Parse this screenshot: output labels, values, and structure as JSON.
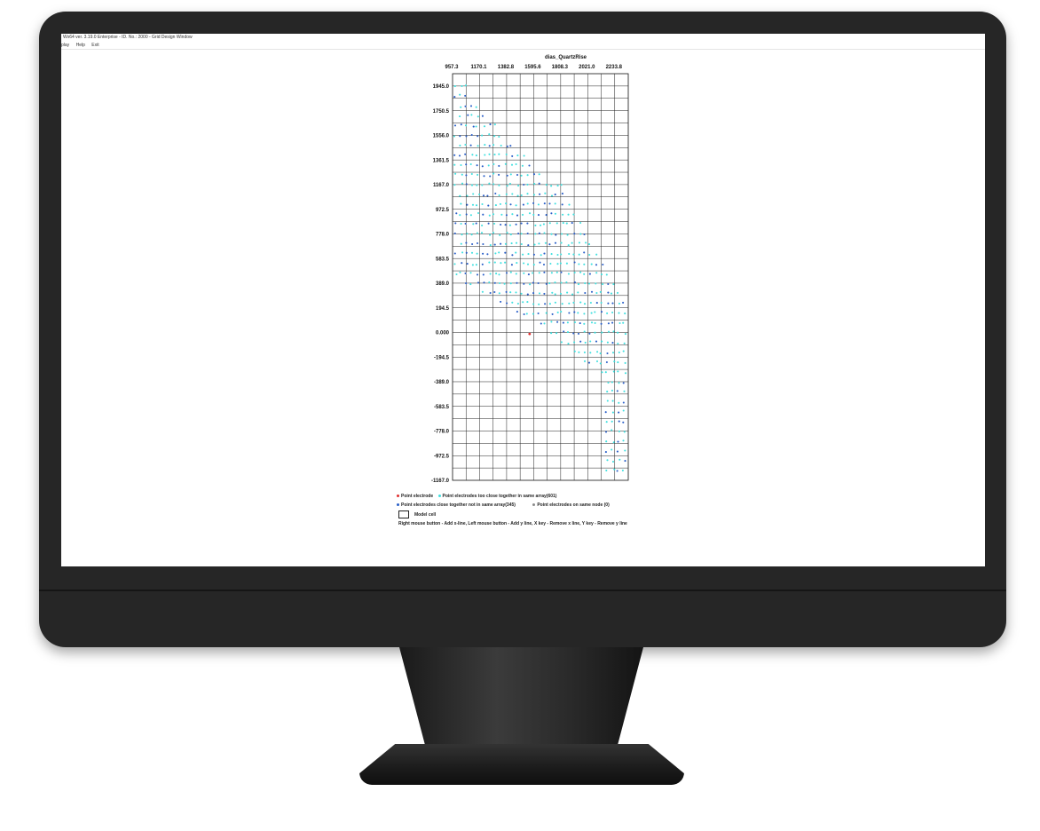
{
  "window": {
    "title": "Wx64 ver. 3.19.0 Enterprise - ID. No.: 2000 - Grid Design Window",
    "menu": [
      "play",
      "Help",
      "Exit"
    ]
  },
  "plot": {
    "title": "dias_QuartzRise",
    "x_tick_labels": [
      "957.3",
      "1170.1",
      "1382.8",
      "1595.6",
      "1808.3",
      "2021.0",
      "2233.8"
    ],
    "y_tick_labels": [
      "1945.0",
      "1750.5",
      "1556.0",
      "1361.5",
      "1167.0",
      "972.5",
      "778.0",
      "583.5",
      "389.0",
      "194.5",
      "0.000",
      "-194.5",
      "-389.0",
      "-583.5",
      "-778.0",
      "-972.5",
      "-1167.0"
    ]
  },
  "legend": {
    "point_electrode": "Point electrode",
    "too_close_same_array": "Point electrodes too close together in same array(601)",
    "close_not_same_array": "Point electrodes close together not in same array(345)",
    "same_node": "Point electrodes on same node (0)",
    "model_cell": "Model cell",
    "instructions": "Right mouse button - Add x-line,  Left mouse button - Add y line,  X key - Remove x line,  Y key - Remove y line"
  },
  "colors": {
    "point_electrode": "#e03030",
    "too_close_same_array": "#40e0e0",
    "close_not_same_array": "#2a5fc8",
    "same_node": "#8a8a8a",
    "monitor_bezel": "#262626"
  },
  "icons": {
    "legend_model_cell": "rectangle-icon"
  }
}
